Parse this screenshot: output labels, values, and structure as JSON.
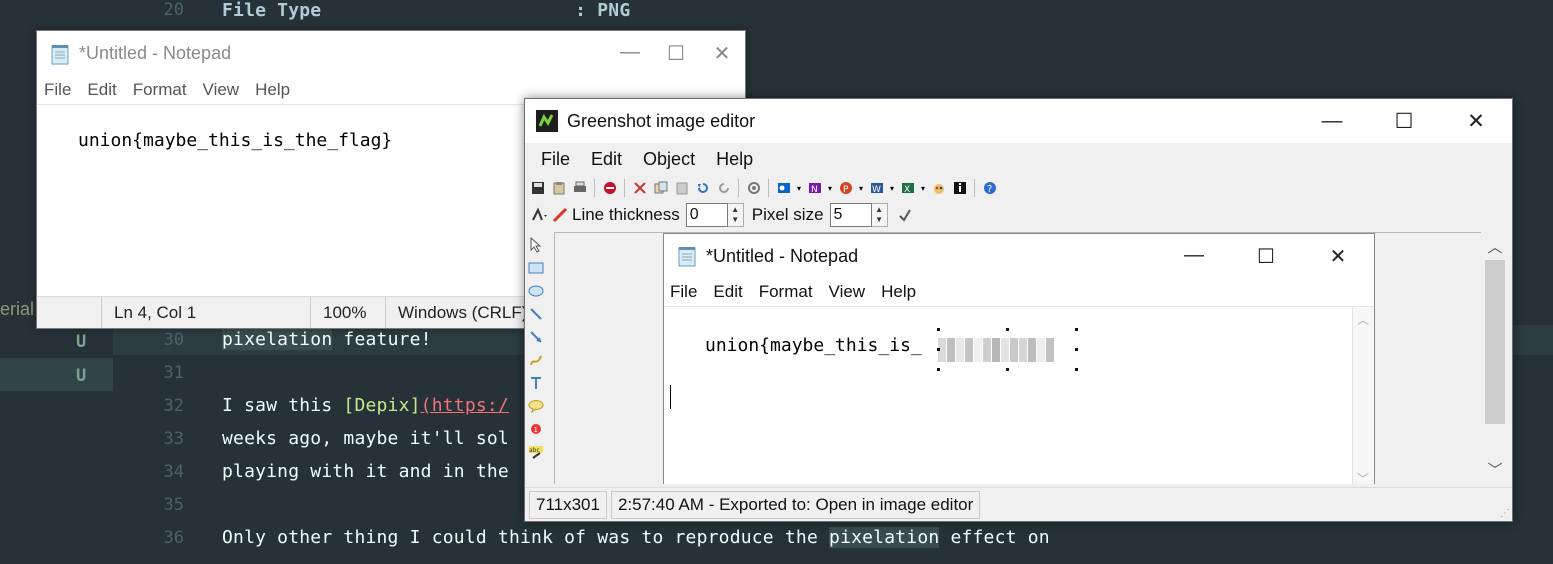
{
  "editor": {
    "top_line": {
      "num": "20",
      "text": "File Type                       : PNG"
    },
    "side_word": "erial",
    "git_marks": [
      "U",
      "U"
    ],
    "line_numbers": [
      "30",
      "31",
      "32",
      "33",
      "34",
      "35",
      "36"
    ],
    "lines": {
      "l30": [
        "pixelation",
        "feature!"
      ],
      "l32_a": "I saw this ",
      "l32_link": "[Depix]",
      "l32_url": "(https:/",
      "l33": "weeks ago, maybe it'll sol",
      "l34": "playing with it and in the",
      "l36_a": "Only other thing I could think of was to reproduce the ",
      "l36_hl": "pixelation",
      "l36_b": " effect on"
    }
  },
  "notepad": {
    "title": "*Untitled - Notepad",
    "menu": [
      "File",
      "Edit",
      "Format",
      "View",
      "Help"
    ],
    "content": "union{maybe_this_is_the_flag}",
    "status": {
      "position": "Ln 4, Col 1",
      "zoom": "100%",
      "line_ending": "Windows (CRLF)"
    },
    "controls": {
      "minimize": "—",
      "maximize": "☐",
      "close": "✕"
    }
  },
  "greenshot": {
    "title": "Greenshot image editor",
    "menu": [
      "File",
      "Edit",
      "Object",
      "Help"
    ],
    "line_thickness_label": "Line thickness",
    "line_thickness_value": "0",
    "pixel_size_label": "Pixel size",
    "pixel_size_value": "5",
    "status": {
      "dimensions": "711x301",
      "message": "2:57:40 AM - Exported to: Open in image editor"
    },
    "controls": {
      "minimize": "—",
      "maximize": "☐",
      "close": "✕"
    },
    "toolbar_icons": [
      "save-icon",
      "clipboard-icon",
      "print-icon",
      "delete-icon",
      "cut-icon",
      "copy-icon",
      "paste-icon",
      "undo-icon",
      "redo-icon",
      "settings-icon",
      "outlook-icon",
      "onenote-icon",
      "powerpoint-icon",
      "word-icon",
      "excel-icon",
      "paint-icon",
      "info-icon",
      "help-icon"
    ],
    "tool_icons": [
      "cursor-icon",
      "rectangle-icon",
      "ellipse-icon",
      "line-icon",
      "arrow-icon",
      "freehand-icon",
      "text-icon",
      "speechbubble-icon",
      "counter-icon",
      "highlight-icon"
    ]
  },
  "embedded_notepad": {
    "title": "*Untitled - Notepad",
    "menu": [
      "File",
      "Edit",
      "Format",
      "View",
      "Help"
    ],
    "content": "union{maybe_this_is_",
    "controls": {
      "minimize": "—",
      "maximize": "☐",
      "close": "✕"
    }
  }
}
